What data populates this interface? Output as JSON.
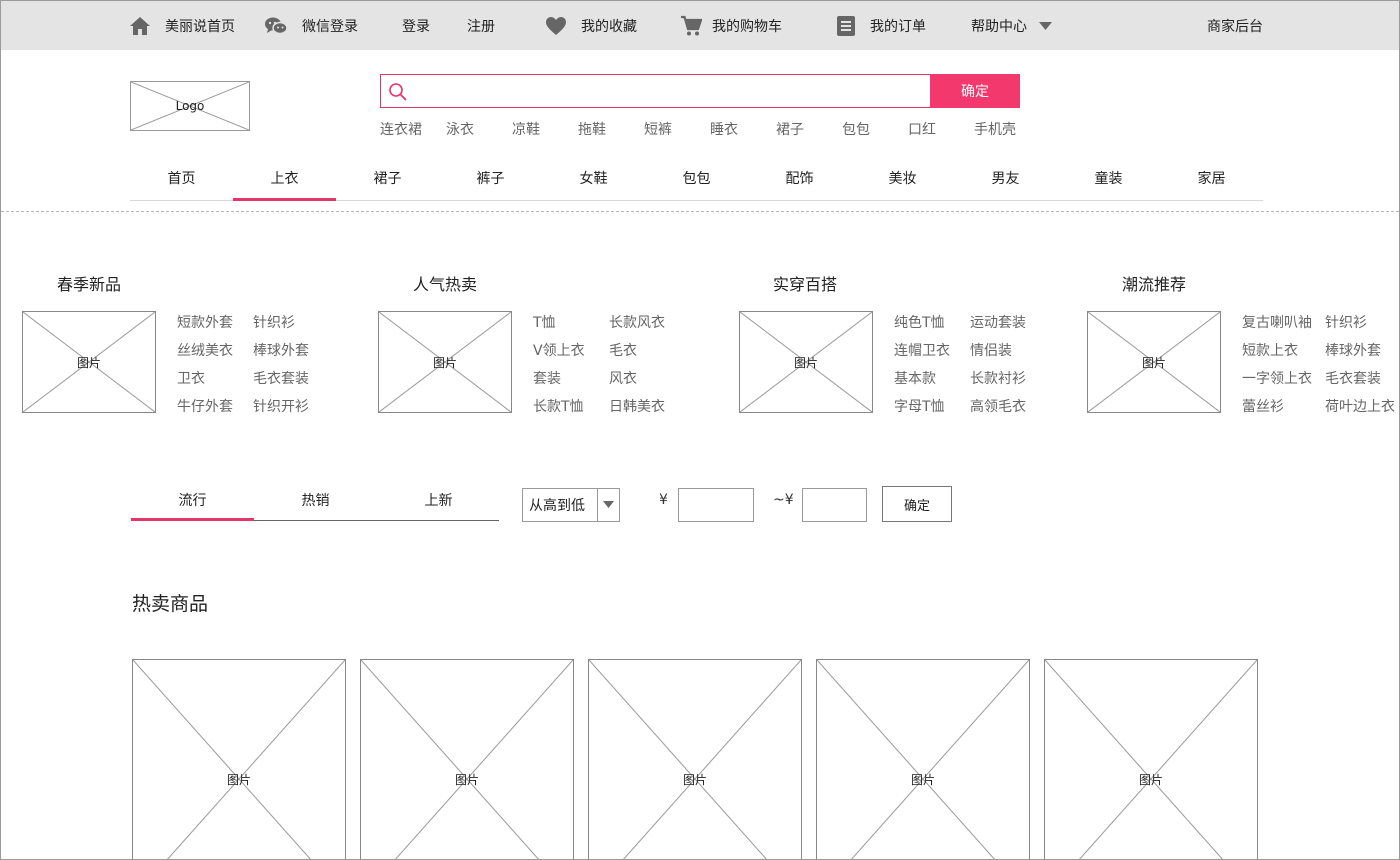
{
  "topbar": {
    "items": [
      {
        "label": "美丽说首页",
        "icon": "home-icon"
      },
      {
        "label": "微信登录",
        "icon": "wechat-icon"
      },
      {
        "label": "登录"
      },
      {
        "label": "注册"
      },
      {
        "label": "我的收藏",
        "icon": "heart-icon"
      },
      {
        "label": "我的购物车",
        "icon": "cart-icon"
      },
      {
        "label": "我的订单",
        "icon": "order-icon"
      },
      {
        "label": "帮助中心",
        "icon": "caret-down-icon"
      },
      {
        "label": "商家后台"
      }
    ]
  },
  "header": {
    "logo_label": "Logo",
    "search": {
      "value": "",
      "placeholder": "",
      "button_label": "确定"
    },
    "hot_words": [
      "连衣裙",
      "泳衣",
      "凉鞋",
      "拖鞋",
      "短裤",
      "睡衣",
      "裙子",
      "包包",
      "口红",
      "手机壳"
    ]
  },
  "category_nav": {
    "items": [
      "首页",
      "上衣",
      "裙子",
      "裤子",
      "女鞋",
      "包包",
      "配饰",
      "美妆",
      "男友",
      "童装",
      "家居"
    ],
    "active_index": 1
  },
  "promo_blocks": [
    {
      "title": "春季新品",
      "image_label": "图片",
      "links": [
        "短款外套",
        "针织衫",
        "丝绒美衣",
        "棒球外套",
        "卫衣",
        "毛衣套装",
        "牛仔外套",
        "针织开衫"
      ]
    },
    {
      "title": "人气热卖",
      "image_label": "图片",
      "links": [
        "T恤",
        "长款风衣",
        "V领上衣",
        "毛衣",
        "套装",
        "风衣",
        "长款T恤",
        "日韩美衣"
      ]
    },
    {
      "title": "实穿百搭",
      "image_label": "图片",
      "links": [
        "纯色T恤",
        "运动套装",
        "连帽卫衣",
        "情侣装",
        "基本款",
        "长款衬衫",
        "字母T恤",
        "高领毛衣"
      ]
    },
    {
      "title": "潮流推荐",
      "image_label": "图片",
      "links": [
        "复古喇叭袖",
        "针织衫",
        "短款上衣",
        "棒球外套",
        "一字领上衣",
        "毛衣套装",
        "蕾丝衫",
        "荷叶边上衣"
      ]
    }
  ],
  "filter": {
    "tabs": [
      "流行",
      "热销",
      "上新"
    ],
    "active_tab": 0,
    "sort_value": "从高到低",
    "price_from_label": "¥",
    "price_to_label": "~¥",
    "price_min": "",
    "price_max": "",
    "ok_label": "确定"
  },
  "hot_products": {
    "title": "热卖商品",
    "items": [
      {
        "image_label": "图片"
      },
      {
        "image_label": "图片"
      },
      {
        "image_label": "图片"
      },
      {
        "image_label": "图片"
      },
      {
        "image_label": "图片"
      }
    ]
  },
  "colors": {
    "accent": "#f2386c",
    "topbar_bg": "#e4e4e4",
    "icon": "#666666"
  }
}
